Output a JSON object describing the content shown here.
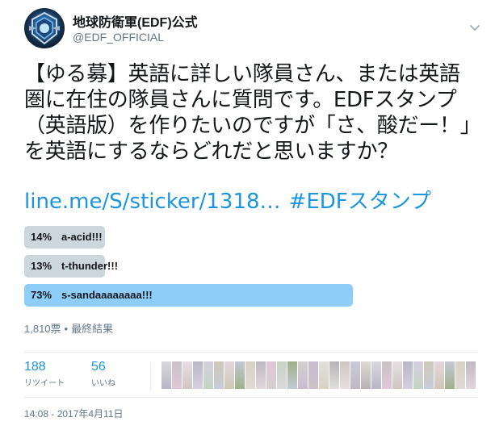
{
  "tweet": {
    "display_name": "地球防衛軍(EDF)公式",
    "handle": "@EDF_OFFICIAL",
    "text": "【ゆる募】英語に詳しい隊員さん、または英語圏に在住の隊員さんに質問です。EDFスタンプ（英語版）を作りたいのですが「さ、酸だー！」を英語にするならどれだと思いますか？",
    "link": "line.me/S/sticker/1318…",
    "hashtag": "#EDFスタンプ"
  },
  "poll": {
    "options": [
      {
        "pct_label": "14%",
        "label": "a-acid!!!",
        "fraction": 0.14,
        "winner": false
      },
      {
        "pct_label": "13%",
        "label": "t-thunder!!!",
        "fraction": 0.13,
        "winner": false
      },
      {
        "pct_label": "73%",
        "label": "s-sandaaaaaaaa!!!",
        "fraction": 0.73,
        "winner": true
      }
    ],
    "votes": "1,810票",
    "status": "最終結果"
  },
  "stats": {
    "retweets_count": "188",
    "retweets_label": "リツイート",
    "likes_count": "56",
    "likes_label": "いいね"
  },
  "timestamp": "14:08 - 2017年4月11日",
  "colors": {
    "link": "#1b95e0",
    "poll_bar": "#ccd6dd",
    "poll_winner": "#8ecdf8",
    "muted": "#657786"
  },
  "icons": {
    "menu": "chevron-down-icon",
    "avatar": "edf-emblem"
  }
}
